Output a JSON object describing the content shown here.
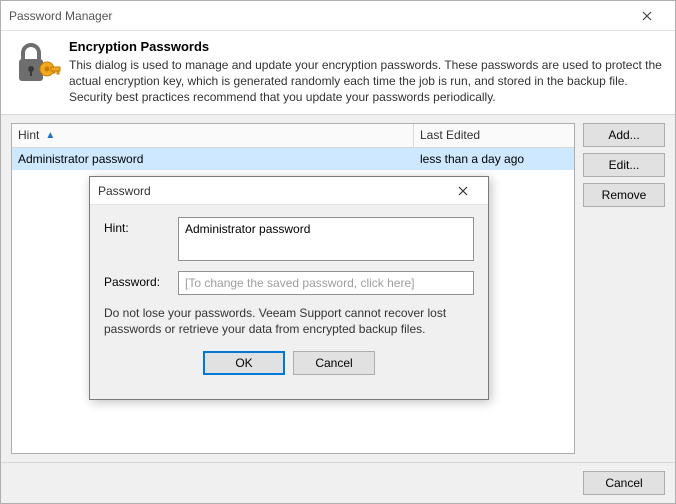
{
  "window": {
    "title": "Password Manager"
  },
  "header": {
    "title": "Encryption Passwords",
    "description": "This dialog is used to manage and update your encryption passwords. These passwords are used to protect the actual encryption key, which is generated randomly each time the job is run, and stored in the backup file. Security best practices recommend that you update your passwords periodically."
  },
  "table": {
    "columns": {
      "hint": "Hint",
      "last_edited": "Last Edited"
    },
    "rows": [
      {
        "hint": "Administrator password",
        "last_edited": "less than a day ago",
        "selected": true
      }
    ]
  },
  "buttons": {
    "add": "Add...",
    "edit": "Edit...",
    "remove": "Remove",
    "cancel": "Cancel",
    "ok": "OK"
  },
  "modal": {
    "title": "Password",
    "hint_label": "Hint:",
    "hint_value": "Administrator password",
    "password_label": "Password:",
    "password_placeholder": "[To change the saved password, click here]",
    "warning": "Do not lose your passwords. Veeam Support cannot recover lost passwords or retrieve your data from encrypted backup files.",
    "ok": "OK",
    "cancel": "Cancel"
  }
}
